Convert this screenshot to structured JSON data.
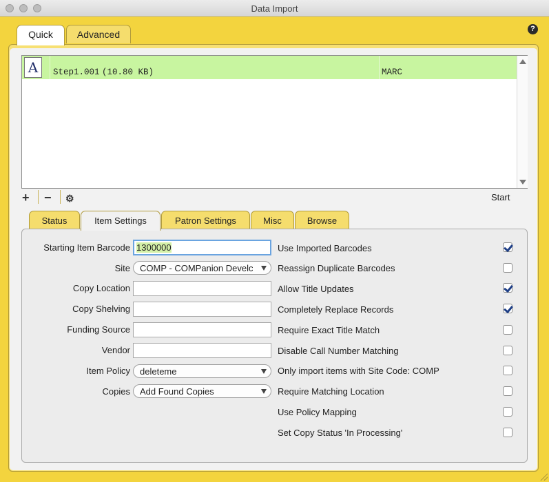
{
  "window": {
    "title": "Data Import"
  },
  "top_tabs": [
    {
      "label": "Quick",
      "active": true
    },
    {
      "label": "Advanced",
      "active": false
    }
  ],
  "file_list": {
    "rows": [
      {
        "icon": "marc-file-icon",
        "name": "Step1.001",
        "size": "(10.80 KB)",
        "format": "MARC",
        "selected": true
      }
    ]
  },
  "toolbar": {
    "add_label": "+",
    "remove_label": "−",
    "start_label": "Start"
  },
  "sub_tabs": [
    {
      "label": "Status",
      "active": false
    },
    {
      "label": "Item Settings",
      "active": true
    },
    {
      "label": "Patron Settings",
      "active": false
    },
    {
      "label": "Misc",
      "active": false
    },
    {
      "label": "Browse",
      "active": false
    }
  ],
  "item_settings": {
    "starting_item_barcode": {
      "label": "Starting Item Barcode",
      "value": "1300000"
    },
    "site": {
      "label": "Site",
      "value": "COMP - COMPanion Develc"
    },
    "copy_location": {
      "label": "Copy Location",
      "value": ""
    },
    "copy_shelving": {
      "label": "Copy Shelving",
      "value": ""
    },
    "funding_source": {
      "label": "Funding Source",
      "value": ""
    },
    "vendor": {
      "label": "Vendor",
      "value": ""
    },
    "item_policy": {
      "label": "Item Policy",
      "value": "deleteme"
    },
    "copies": {
      "label": "Copies",
      "value": "Add Found Copies"
    }
  },
  "options": [
    {
      "label": "Use Imported Barcodes",
      "checked": true
    },
    {
      "label": "Reassign Duplicate Barcodes",
      "checked": false
    },
    {
      "label": "Allow Title Updates",
      "checked": true
    },
    {
      "label": "Completely Replace Records",
      "checked": true
    },
    {
      "label": "Require Exact Title Match",
      "checked": false
    },
    {
      "label": "Disable Call Number Matching",
      "checked": false
    },
    {
      "label": "Only import items with Site Code: COMP",
      "checked": false
    },
    {
      "label": "Require Matching Location",
      "checked": false
    },
    {
      "label": "Use Policy Mapping",
      "checked": false
    },
    {
      "label": "Set Copy Status 'In Processing'",
      "checked": false
    }
  ],
  "colors": {
    "window_background": "#f3d43e",
    "selected_row": "#c8f5a0",
    "checkbox_mark": "#1f3f86"
  }
}
